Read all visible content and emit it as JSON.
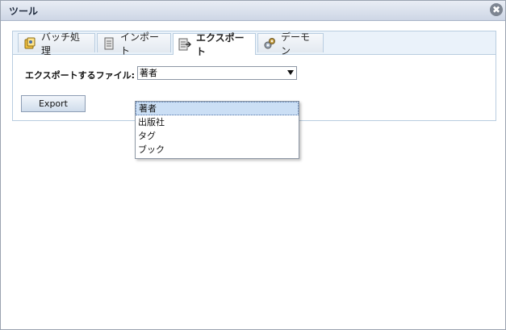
{
  "window": {
    "title": "ツール",
    "close_label": "✖"
  },
  "tabs": [
    {
      "label": "バッチ処理",
      "icon": "batch-icon",
      "active": false
    },
    {
      "label": "インポート",
      "icon": "import-icon",
      "active": false
    },
    {
      "label": "エクスポート",
      "icon": "export-icon",
      "active": true
    },
    {
      "label": "デーモン",
      "icon": "daemon-icon",
      "active": false
    }
  ],
  "export_form": {
    "label": "エクスポートするファイル:",
    "selected_value": "著者",
    "options": [
      "著者",
      "出版社",
      "タグ",
      "ブック"
    ],
    "button_label": "Export"
  },
  "colors": {
    "tab_bar_bg": "#eaf2fa",
    "panel_border": "#b9cde0",
    "selected_option_bg": "#cbdff5"
  }
}
